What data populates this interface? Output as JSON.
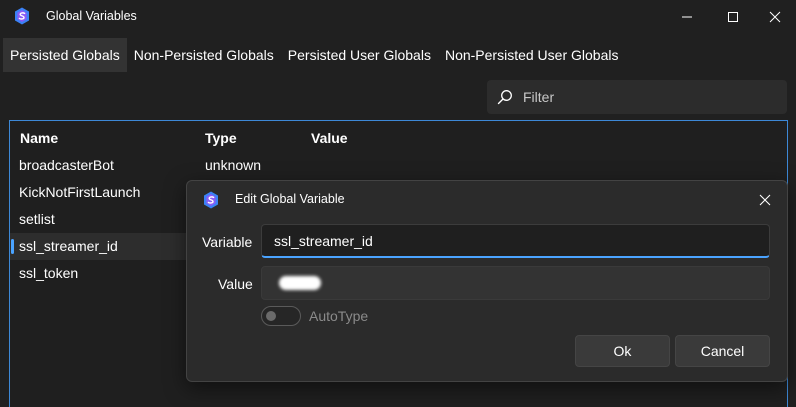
{
  "window": {
    "title": "Global Variables"
  },
  "tabs": [
    {
      "label": "Persisted Globals",
      "active": true
    },
    {
      "label": "Non-Persisted Globals",
      "active": false
    },
    {
      "label": "Persisted User Globals",
      "active": false
    },
    {
      "label": "Non-Persisted User Globals",
      "active": false
    }
  ],
  "filter": {
    "placeholder": "Filter",
    "icon": "search-icon"
  },
  "grid": {
    "columns": [
      "Name",
      "Type",
      "Value"
    ],
    "rows": [
      {
        "name": "broadcasterBot",
        "type": "unknown",
        "selected": false
      },
      {
        "name": "KickNotFirstLaunch",
        "type": "",
        "selected": false
      },
      {
        "name": "setlist",
        "type": "",
        "selected": false
      },
      {
        "name": "ssl_streamer_id",
        "type": "",
        "selected": true
      },
      {
        "name": "ssl_token",
        "type": "",
        "selected": false
      }
    ]
  },
  "dialog": {
    "title": "Edit Global Variable",
    "variable_label": "Variable",
    "variable_value": "ssl_streamer_id",
    "value_label": "Value",
    "autotype_label": "AutoType",
    "autotype_on": false,
    "ok_label": "Ok",
    "cancel_label": "Cancel"
  },
  "colors": {
    "background": "#202020",
    "accent": "#4aa3ff",
    "grid_border": "#3d88d6",
    "dialog_bg": "#2b2b2b",
    "logo_blue": "#3b82f6",
    "logo_purple": "#8b5cf6"
  }
}
